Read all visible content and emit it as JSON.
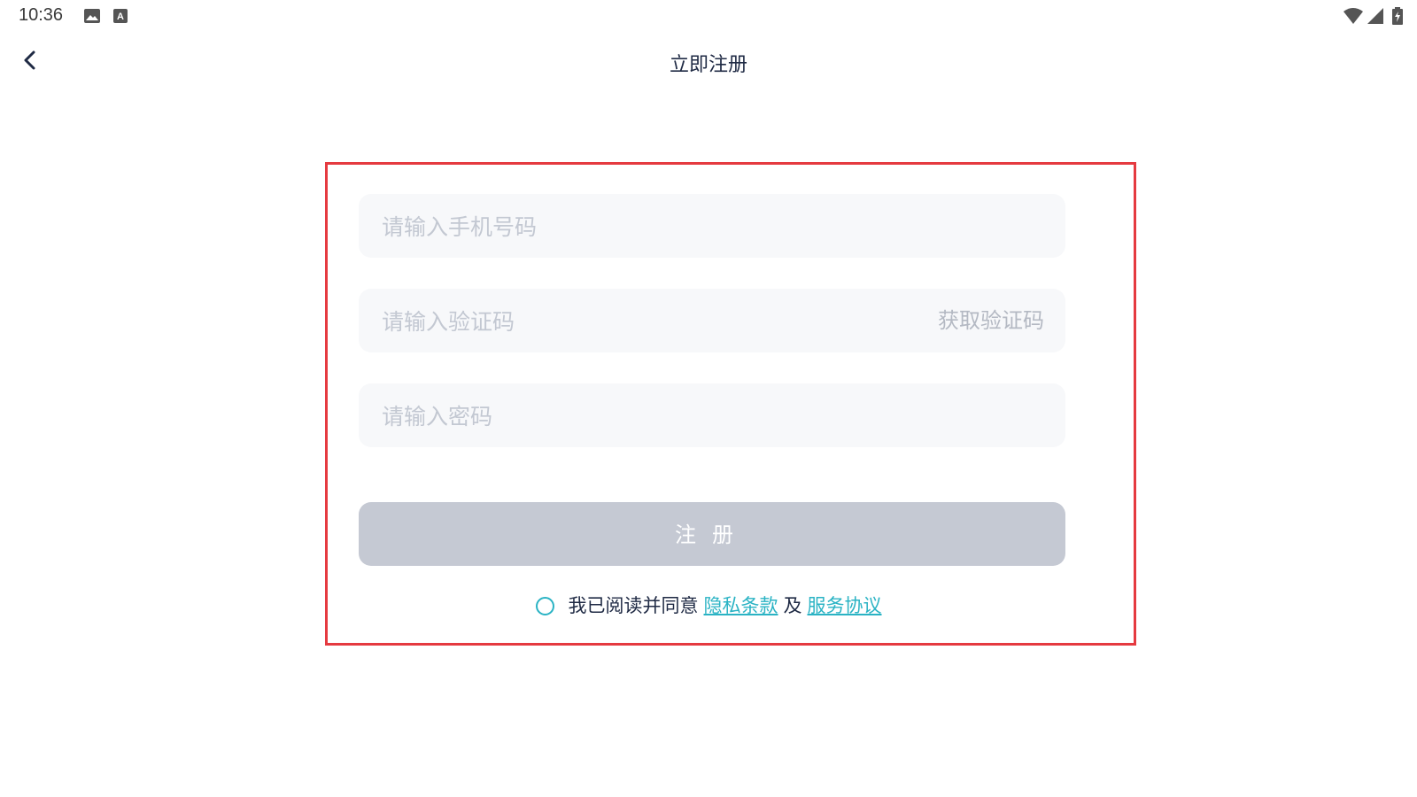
{
  "status_bar": {
    "time": "10:36",
    "left_icons": [
      "image-icon",
      "keyboard-a-icon"
    ],
    "right_icons": [
      "wifi-icon",
      "signal-icon",
      "battery-charging-icon"
    ]
  },
  "header": {
    "back_icon": "chevron-left-icon",
    "title": "立即注册"
  },
  "form": {
    "phone_placeholder": "请输入手机号码",
    "phone_value": "",
    "code_placeholder": "请输入验证码",
    "code_value": "",
    "get_code_label": "获取验证码",
    "password_placeholder": "请输入密码",
    "password_value": "",
    "register_label": "注册"
  },
  "agreement": {
    "checked": false,
    "prefix": "我已阅读并同意",
    "privacy_link": "隐私条款",
    "connector": "及",
    "service_link": "服务协议"
  },
  "colors": {
    "accent": "#2ab3c4",
    "button_disabled": "#c5c9d3",
    "field_bg": "#f7f8fa",
    "highlight_frame": "#e53a40",
    "title_text": "#1f2a44",
    "placeholder": "#c3c8d2"
  }
}
